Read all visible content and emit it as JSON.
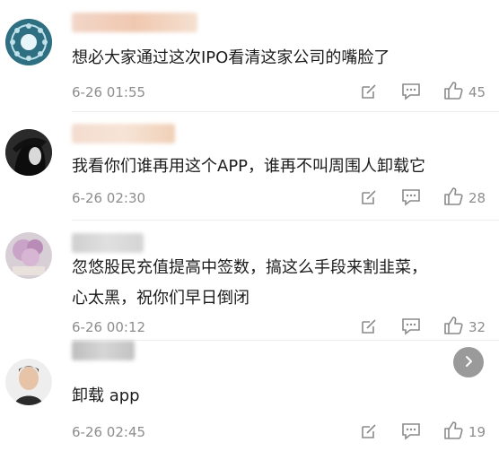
{
  "comments": [
    {
      "text": "想必大家通过这次IPO看清这家公司的嘴脸了",
      "time": "6-26 01:55",
      "likes": "45"
    },
    {
      "text": "我看你们谁再用这个APP，谁再不叫周围人卸载它",
      "time": "6-26 02:30",
      "likes": "28"
    },
    {
      "text_line1": "忽悠股民充值提高中签数，搞这么手段来割韭菜，",
      "text_line2": "心太黑，祝你们早日倒闭",
      "time": "6-26 00:12",
      "likes": "32"
    },
    {
      "text": "卸载 app",
      "time": "6-26 02:45",
      "likes": "19"
    }
  ],
  "icons": {
    "edit": "edit-icon",
    "reply": "comment-icon",
    "like": "thumbs-up-icon",
    "next": "chevron-right-icon"
  },
  "colors": {
    "meta": "#8d8d8d",
    "text": "#1c1c1c",
    "icon": "#8a8a8a"
  }
}
